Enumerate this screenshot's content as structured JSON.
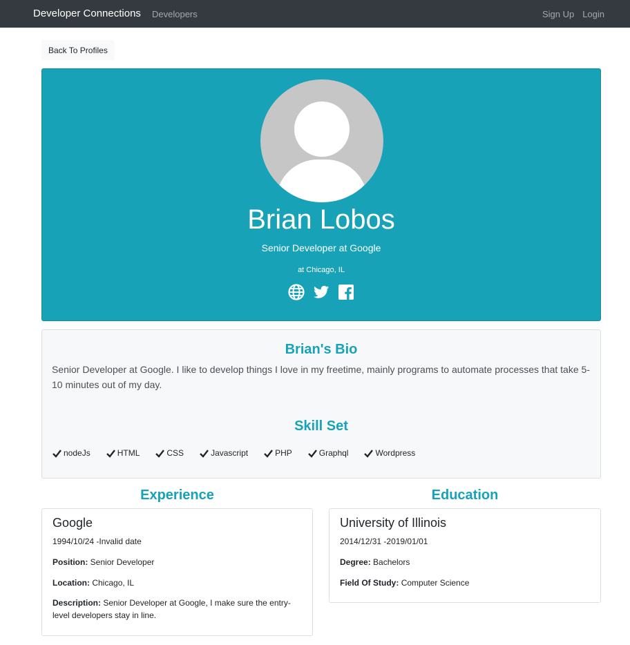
{
  "navbar": {
    "brand": "Developer Connections",
    "developers_link": "Developers",
    "signup_link": "Sign Up",
    "login_link": "Login"
  },
  "back_button": "Back To Profiles",
  "profile": {
    "name": "Brian Lobos",
    "tagline": "Senior Developer at Google",
    "location": "at Chicago, IL",
    "socials": [
      "globe-icon",
      "twitter-icon",
      "facebook-icon"
    ]
  },
  "bio": {
    "title": "Brian's Bio",
    "text": "Senior Developer at Google. I like to develop things I love in my freetime, mainly programs to automate processes that take 5-10 minutes out of my day."
  },
  "skills": {
    "title": "Skill Set",
    "items": [
      "nodeJs",
      "HTML",
      "CSS",
      "Javascript",
      "PHP",
      "Graphql",
      "Wordpress"
    ]
  },
  "experience": {
    "title": "Experience",
    "company": "Google",
    "dates": "1994/10/24 -Invalid date",
    "position_label": "Position:",
    "position": "Senior Developer",
    "location_label": "Location:",
    "location": "Chicago, IL",
    "description_label": "Description:",
    "description": "Senior Developer at Google, I make sure the entry-level developers stay in line."
  },
  "education": {
    "title": "Education",
    "school": "University of Illinois",
    "dates": "2014/12/31 -2019/01/01",
    "degree_label": "Degree:",
    "degree": "Bachelors",
    "field_label": "Field Of Study:",
    "field": "Computer Science"
  },
  "colors": {
    "navbar": "#343a40",
    "accent": "#17a2b8",
    "bio_bg": "#f7f8f9"
  }
}
